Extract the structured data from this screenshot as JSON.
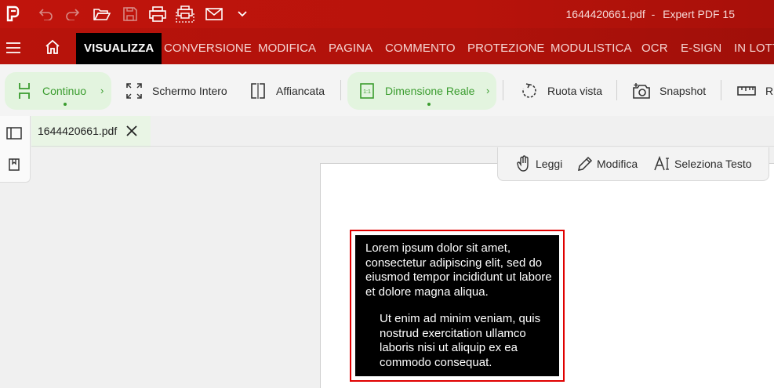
{
  "window": {
    "file_name": "1644420661.pdf",
    "separator": "-",
    "app_name": "Expert PDF 15"
  },
  "ribbon_tabs": [
    {
      "label": "VISUALIZZA",
      "active": true
    },
    {
      "label": "CONVERSIONE"
    },
    {
      "label": "MODIFICA"
    },
    {
      "label": "PAGINA"
    },
    {
      "label": "COMMENTO"
    },
    {
      "label": "PROTEZIONE"
    },
    {
      "label": "MODULISTICA"
    },
    {
      "label": "OCR"
    },
    {
      "label": "E-SIGN"
    },
    {
      "label": "IN LOTT"
    }
  ],
  "toolbar": {
    "continuous": {
      "label": "Continuo",
      "icon": "continuous-scroll-icon"
    },
    "fullscreen": {
      "label": "Schermo Intero",
      "icon": "fullscreen-icon"
    },
    "side_by_side": {
      "label": "Affiancata",
      "icon": "side-by-side-icon"
    },
    "actual_size": {
      "label": "Dimensione Reale",
      "icon": "actual-size-icon"
    },
    "rotate": {
      "label": "Ruota vista",
      "icon": "rotate-icon"
    },
    "snapshot": {
      "label": "Snapshot",
      "icon": "camera-icon"
    },
    "ruler": {
      "label": "Ri",
      "icon": "ruler-icon"
    }
  },
  "document_tab": {
    "label": "1644420661.pdf"
  },
  "modes": {
    "read": "Leggi",
    "edit": "Modifica",
    "select_text": "Seleziona Testo"
  },
  "pdf_content": {
    "para1": "Lorem ipsum dolor sit amet, consectetur adipiscing elit, sed do eiusmod tempor incididunt ut labore et dolore magna aliqua.",
    "para2": "Ut enim ad minim veniam, quis nostrud exercitation ullamco laboris nisi ut aliquip ex ea commodo consequat."
  },
  "colors": {
    "brand_red": "#b8130b",
    "accent_green": "#3a9c2e",
    "selection_red": "#e00000"
  }
}
